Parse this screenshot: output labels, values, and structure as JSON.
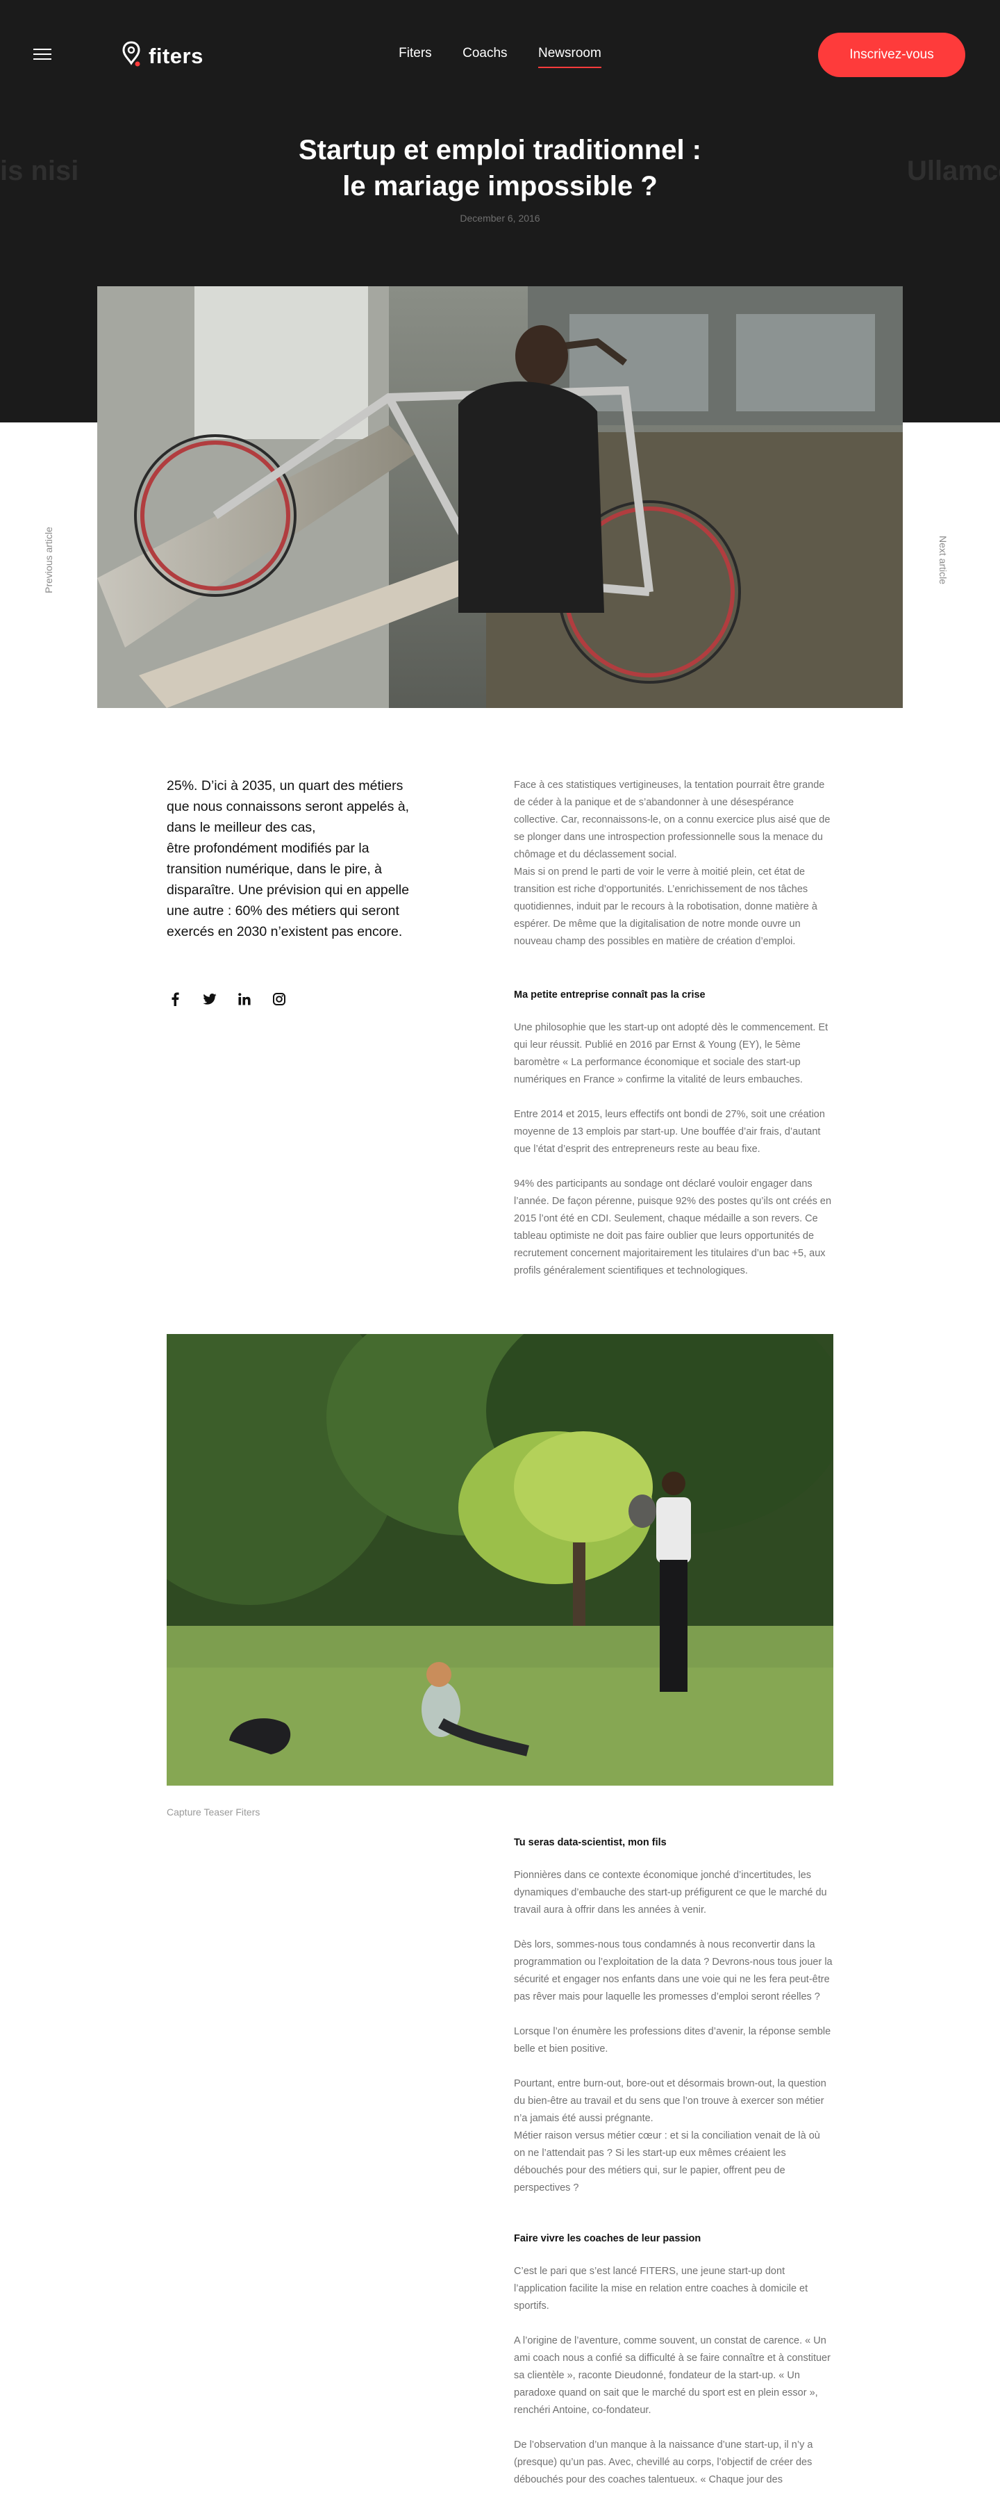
{
  "header": {
    "menu_icon": "hamburger-icon",
    "logo_icon": "location-pin-icon",
    "logo_text": "fiters",
    "nav": [
      {
        "label": "Fiters"
      },
      {
        "label": "Coachs"
      },
      {
        "label": "Newsroom",
        "active": true
      }
    ],
    "cta_label": "Inscrivez-vous"
  },
  "hero": {
    "bg_text_left": "oris nisi",
    "bg_text_right": "Ullamco",
    "title_line1": "Startup et emploi traditionnel :",
    "title_line2": "le mariage impossible ?",
    "date": "December 6, 2016"
  },
  "side_nav": {
    "previous": "Previous article",
    "next": "Next article"
  },
  "lead": {
    "lines": [
      "25%. D’ici à 2035, un quart des métiers",
      "que nous connaissons seront appelés à,",
      "dans le meilleur des cas,",
      "être profondément modifiés par la",
      "transition numérique, dans le pire, à",
      "disparaître. Une prévision qui en appelle",
      "une autre : 60% des métiers qui seront",
      "exercés en 2030 n’existent pas encore."
    ]
  },
  "social": [
    "facebook-icon",
    "twitter-icon",
    "linkedin-icon",
    "instagram-icon"
  ],
  "article": {
    "intro": [
      "Face à ces statistiques vertigineuses, la tentation pourrait être grande de céder à la panique et de s’abandonner à une désespérance collective. Car, reconnaissons-le, on a connu exercice plus aisé que de se plonger dans une introspection professionnelle sous la menace du chômage et du déclassement social.",
      "Mais si on prend le parti de voir le verre à moitié plein, cet état de transition est riche d’opportunités. L’enrichissement de nos tâches quotidiennes, induit par le recours à la robotisation, donne matière à espérer. De même que la digitalisation de notre monde ouvre un nouveau champ des possibles en matière de création d’emploi."
    ],
    "section1_title": "Ma petite entreprise connaît pas la crise",
    "section1": [
      "Une philosophie que les start-up ont adopté dès le commencement. Et qui leur réussit. Publié en 2016 par Ernst & Young (EY), le 5ème baromètre « La performance économique et sociale des start-up numériques en France » confirme la vitalité de leurs embauches.",
      "Entre 2014 et 2015, leurs effectifs ont bondi de 27%, soit une création moyenne de 13 emplois par start-up. Une bouffée d’air frais, d’autant que l’état d’esprit des entrepreneurs reste au beau fixe.",
      "94% des participants au sondage ont déclaré vouloir engager dans l’année. De façon pérenne, puisque 92% des postes qu’ils ont créés en 2015 l’ont été en CDI. Seulement, chaque médaille a son revers. Ce tableau optimiste ne doit pas faire oublier que leurs opportunités de recrutement concernent majoritairement les titulaires d’un bac +5, aux profils généralement scientifiques et technologiques."
    ],
    "image_caption": "Capture Teaser Fiters",
    "section2_title": "Tu seras data-scientist, mon fils",
    "section2": [
      "Pionnières dans ce contexte économique jonché d’incertitudes, les dynamiques d’embauche des start-up préfigurent ce que le marché du travail aura à offrir dans les années à venir.",
      "Dès lors, sommes-nous tous condamnés à nous reconvertir dans la programmation ou l’exploitation de la data ? Devrons-nous tous jouer la sécurité et engager nos enfants dans une voie qui ne les fera peut-être pas rêver mais pour laquelle les promesses d’emploi seront réelles ?",
      "Lorsque l’on énumère les professions dites d’avenir, la réponse semble belle et bien positive.",
      "Pourtant, entre burn-out, bore-out et désormais brown-out, la question du bien-être au travail et du sens que l’on trouve à exercer son métier n’a jamais été aussi prégnante.",
      "Métier raison versus métier cœur : et si la conciliation venait de là où on ne l’attendait pas ? Si les start-up eux mêmes créaient les débouchés pour des métiers qui, sur le papier, offrent peu de perspectives ?"
    ],
    "section3_title": "Faire vivre les coaches de leur passion",
    "section3": [
      "C’est le pari que s’est lancé FITERS, une jeune start-up dont l’application facilite la mise en relation entre coaches à domicile et sportifs.",
      "A l’origine de l’aventure, comme souvent, un constat de carence. « Un ami coach nous a confié sa difficulté à se faire connaître et à constituer sa clientèle », raconte Dieudonné, fondateur de la start-up. « Un paradoxe quand on sait que le marché du sport est en plein essor », renchéri Antoine, co-fondateur.",
      "De l’observation d’un manque à la naissance d’une start-up, il n’y a (presque) qu’un pas. Avec, chevillé au corps, l’objectif de créer des débouchés pour des coaches talentueux. « Chaque jour des"
    ]
  },
  "colors": {
    "accent": "#fe3b3b",
    "dark_bg": "#1b1b1b",
    "body_text": "#707070"
  }
}
